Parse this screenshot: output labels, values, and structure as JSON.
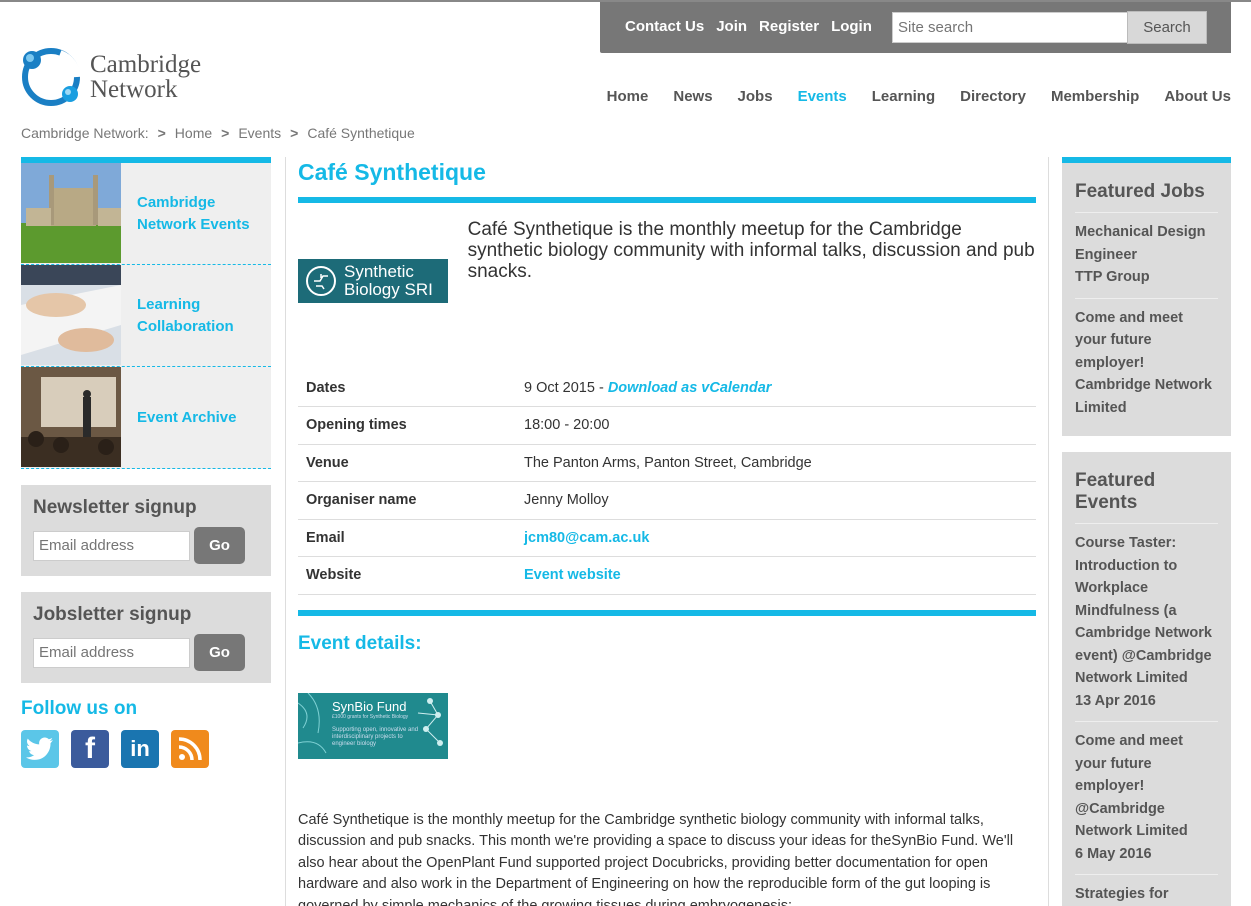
{
  "topbar": {
    "links": [
      "Contact Us",
      "Join",
      "Register",
      "Login"
    ],
    "search_placeholder": "Site search",
    "search_button": "Search"
  },
  "logo": {
    "line1": "Cambridge",
    "line2": "Network"
  },
  "nav": {
    "items": [
      "Home",
      "News",
      "Jobs",
      "Events",
      "Learning",
      "Directory",
      "Membership",
      "About Us"
    ],
    "active": "Events"
  },
  "breadcrumb": [
    "Cambridge Network:",
    "Home",
    "Events",
    "Café Synthetique"
  ],
  "left": {
    "event_nav": [
      {
        "label": "Cambridge\nNetwork Events"
      },
      {
        "label": "Learning\nCollaboration"
      },
      {
        "label": "Event Archive"
      }
    ],
    "newsletter": {
      "title": "Newsletter signup",
      "placeholder": "Email address",
      "button": "Go"
    },
    "jobsletter": {
      "title": "Jobsletter signup",
      "placeholder": "Email address",
      "button": "Go"
    },
    "follow_title": "Follow us on",
    "social": [
      "twitter-icon",
      "facebook-icon",
      "linkedin-icon",
      "rss-icon"
    ]
  },
  "event": {
    "title": "Café Synthetique",
    "logo_text": "Synthetic\nBiology SRI",
    "intro": "Café Synthetique is the monthly meetup for the Cambridge synthetic biology community with informal talks, discussion and pub snacks.",
    "details": {
      "dates_label": "Dates",
      "dates_value": "9 Oct 2015 - ",
      "dates_link": "Download as vCalendar",
      "opening_label": "Opening times",
      "opening_value": "18:00 - 20:00",
      "venue_label": "Venue",
      "venue_value": "The Panton Arms, Panton Street, Cambridge",
      "organiser_label": "Organiser name",
      "organiser_value": "Jenny Molloy",
      "email_label": "Email",
      "email_value": "jcm80@cam.ac.uk",
      "website_label": "Website",
      "website_value": "Event website"
    },
    "details_heading": "Event details:",
    "fund_logo": {
      "title": "SynBio Fund",
      "subtitle": "£1000 grants for Synthetic Biology",
      "tagline": "Supporting open, innovative and interdisciplinary projects to engineer biology"
    },
    "body": "Café Synthetique is the monthly meetup for the Cambridge synthetic biology community with informal talks, discussion and pub snacks. This month we're providing a space to discuss your ideas for theSynBio Fund. We'll also hear about the OpenPlant Fund supported project Docubricks, providing better documentation for open hardware and also work in the Department of Engineering on how the reproducible form of the gut looping is governed by simple mechanics of the growing tissues during embryogenesis:"
  },
  "right": {
    "featured_jobs": {
      "title": "Featured Jobs",
      "items": [
        "Mechanical Design\nEngineer\nTTP Group",
        "Come and meet\nyour future\nemployer!\nCambridge Network\nLimited"
      ]
    },
    "featured_events": {
      "title": "Featured\nEvents",
      "items": [
        "Course Taster:\nIntroduction to\nWorkplace\nMindfulness (a\nCambridge Network\nevent) @Cambridge\nNetwork Limited\n13 Apr 2016",
        "Come and meet\nyour future\nemployer!\n@Cambridge\nNetwork Limited\n6 May 2016",
        "Strategies for\nWinning in China"
      ]
    }
  },
  "colors": {
    "accent": "#15b9e6",
    "topbar": "#777777",
    "panel": "#dcdcdc"
  }
}
